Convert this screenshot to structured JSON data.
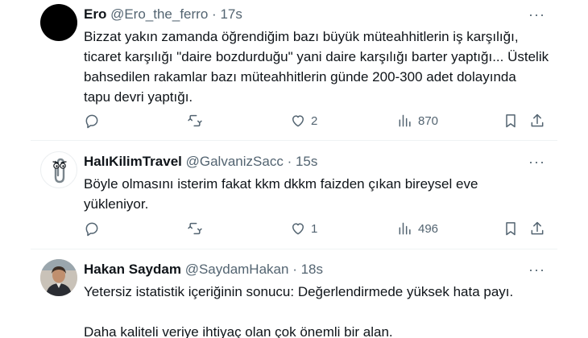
{
  "tweets": [
    {
      "name": "Ero",
      "handle": "@Ero_the_ferro",
      "sep": "·",
      "time": "17s",
      "lines": [
        "Bizzat yakın zamanda öğrendiğim bazı büyük müteahhitlerin iş karşılığı,",
        "ticaret karşılığı \"daire bozdurduğu\" yani daire karşılığı barter yaptığı... Üstelik",
        "bahsedilen rakamlar bazı müteahhitlerin günde 200-300 adet dolayında",
        "tapu devri yaptığı."
      ],
      "likes": "2",
      "views": "870"
    },
    {
      "name": "HalıKilimTravel",
      "handle": "@GalvanizSacc",
      "sep": "·",
      "time": "15s",
      "lines": [
        "Böyle olmasını isterim fakat kkm dkkm faizden çıkan bireysel eve",
        "yükleniyor."
      ],
      "likes": "1",
      "views": "496"
    },
    {
      "name": "Hakan Saydam",
      "handle": "@SaydamHakan",
      "sep": "·",
      "time": "18s",
      "lines": [
        "Yetersiz istatistik içeriğinin sonucu: Değerlendirmede yüksek hata payı.",
        "",
        "Daha kaliteli veriye ihtiyaç olan çok önemli bir alan."
      ]
    }
  ],
  "icons": {
    "more": "more-icon",
    "reply": "reply-icon",
    "retweet": "retweet-icon",
    "like": "heart-icon",
    "views": "views-icon",
    "bookmark": "bookmark-icon",
    "share": "share-icon"
  },
  "colors": {
    "text": "#0f1419",
    "secondary": "#536471",
    "divider": "#eff3f4"
  }
}
